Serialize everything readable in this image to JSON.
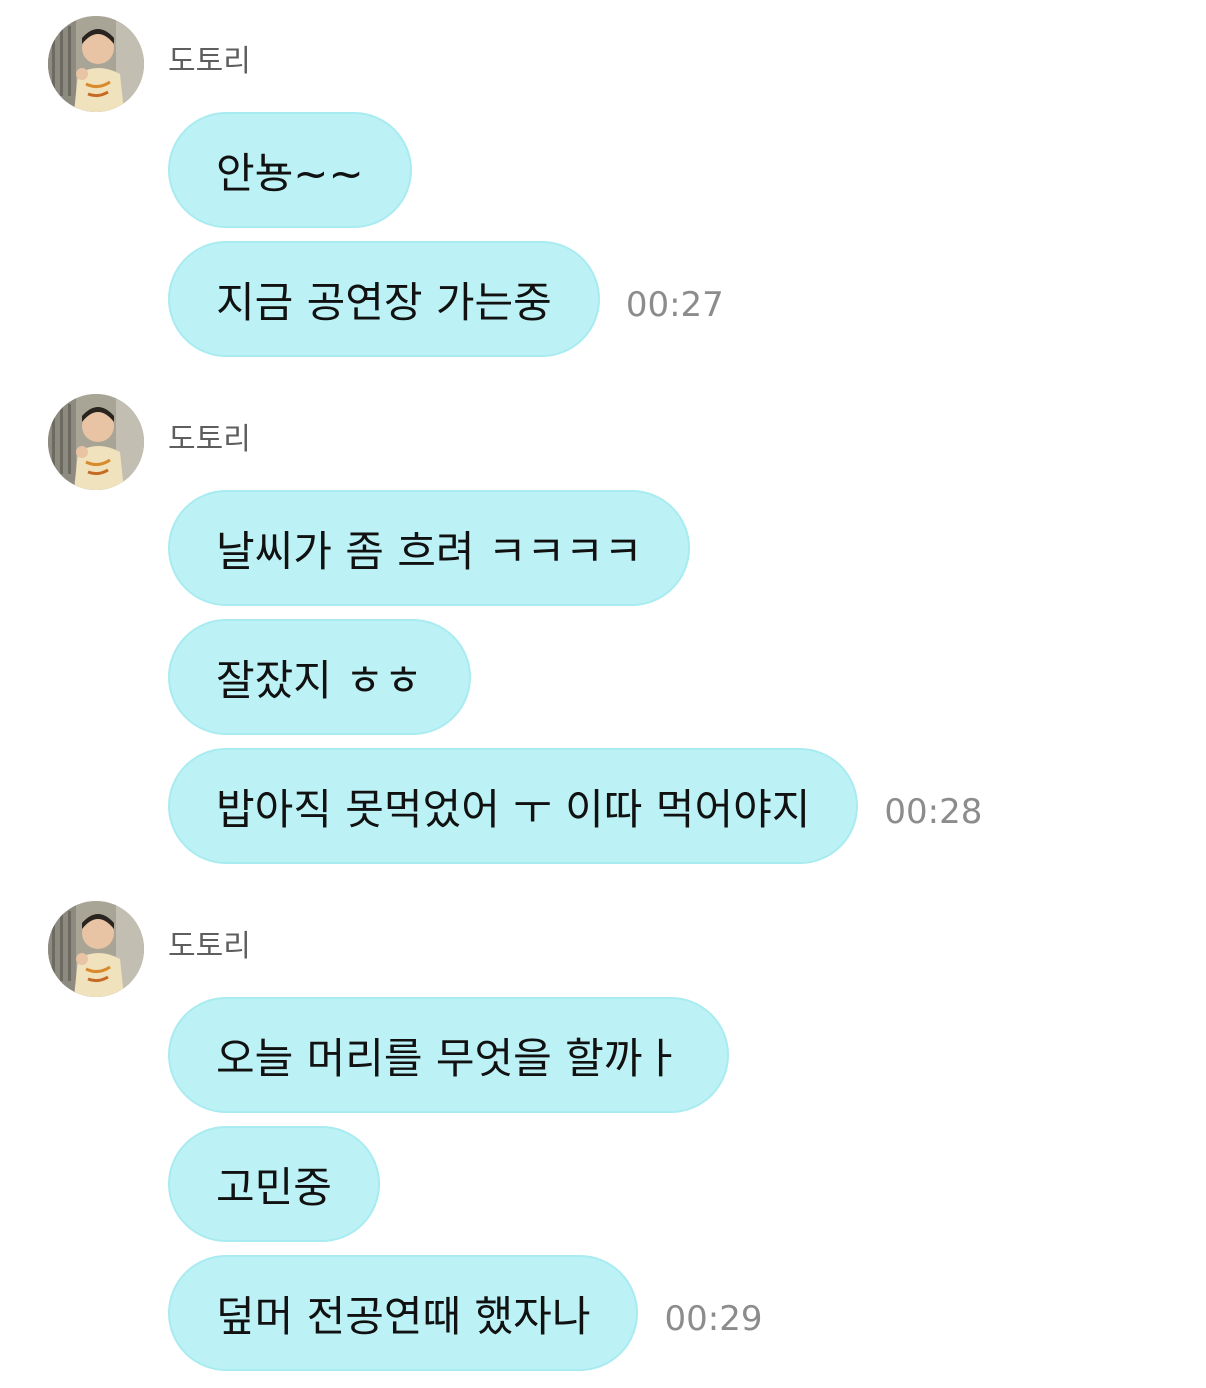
{
  "groups": [
    {
      "sender": "도토리",
      "avatar_icon": "profile-photo-icon",
      "messages": [
        {
          "text": "안뇽~~",
          "time": ""
        },
        {
          "text": "지금 공연장 가는중",
          "time": "00:27"
        }
      ]
    },
    {
      "sender": "도토리",
      "avatar_icon": "profile-photo-icon",
      "messages": [
        {
          "text": "날씨가 좀 흐려 ㅋㅋㅋㅋ",
          "time": ""
        },
        {
          "text": "잘잤지 ㅎㅎ",
          "time": ""
        },
        {
          "text": "밥아직 못먹었어 ㅜ 이따 먹어야지",
          "time": "00:28"
        }
      ]
    },
    {
      "sender": "도토리",
      "avatar_icon": "profile-photo-icon",
      "messages": [
        {
          "text": "오늘 머리를 무엇을 할까ㅏ",
          "time": ""
        },
        {
          "text": "고민중",
          "time": ""
        },
        {
          "text": "덮머 전공연때 했자나",
          "time": "00:29"
        }
      ]
    }
  ],
  "colors": {
    "bubble": "#bcf2f5",
    "bubble_border": "#a8ebf0",
    "sender_text": "#5e5e5e",
    "time_text": "#8c8c8c"
  }
}
